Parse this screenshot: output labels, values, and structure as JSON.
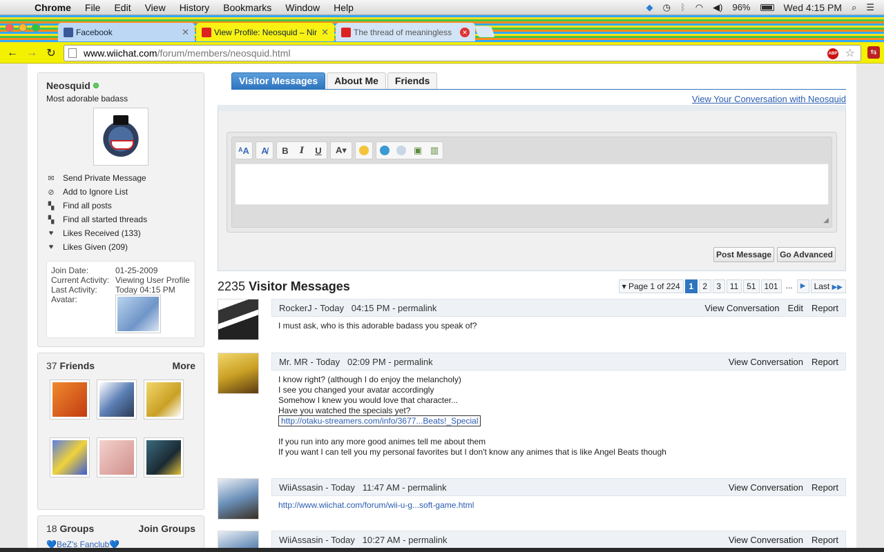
{
  "menubar": {
    "app": "Chrome",
    "items": [
      "File",
      "Edit",
      "View",
      "History",
      "Bookmarks",
      "Window",
      "Help"
    ],
    "battery": "96%",
    "clock": "Wed 4:15 PM"
  },
  "tabs": [
    {
      "title": "Facebook"
    },
    {
      "title": "View Profile: Neosquid – Nin"
    },
    {
      "title": "The thread of meaningless"
    }
  ],
  "toolbar": {
    "url_host": "www.wiichat.com",
    "url_path": "/forum/members/neosquid.html",
    "abp_label": "ABP"
  },
  "profile": {
    "username": "Neosquid",
    "user_title": "Most adorable badass",
    "links": [
      {
        "label": "Send Private Message",
        "icon": "envelope-icon"
      },
      {
        "label": "Add to Ignore List",
        "icon": "block-icon"
      },
      {
        "label": "Find all posts",
        "icon": "posts-icon"
      },
      {
        "label": "Find all started threads",
        "icon": "threads-icon"
      },
      {
        "label": "Likes Received (133)",
        "icon": "heart-icon"
      },
      {
        "label": "Likes Given (209)",
        "icon": "heart-icon"
      }
    ],
    "stats": {
      "join_label": "Join Date:",
      "join_value": "01-25-2009",
      "activity_label": "Current Activity:",
      "activity_value": "Viewing User Profile",
      "last_label": "Last Activity:",
      "last_value": "Today 04:15 PM",
      "avatar_label": "Avatar:"
    }
  },
  "friends": {
    "count": "37",
    "label": "Friends",
    "more": "More",
    "colors": [
      "#e0672a",
      "#5c7fb6",
      "#e8c33e",
      "#3c5bd6",
      "#e8b9b5",
      "#2a4a5e"
    ]
  },
  "groups": {
    "count": "18",
    "label": "Groups",
    "join": "Join Groups",
    "first": "💙BeZ's Fanclub💙"
  },
  "main": {
    "tabs": [
      "Visitor Messages",
      "About Me",
      "Friends"
    ],
    "conv_link": "View Your Conversation with Neosquid",
    "post_button": "Post Message",
    "advanced_button": "Go Advanced",
    "count": "2235",
    "title": "Visitor Messages",
    "pager": {
      "label": "Page 1 of 224",
      "pages": [
        "1",
        "2",
        "3",
        "11",
        "51",
        "101"
      ],
      "ellipsis": "...",
      "last": "Last"
    }
  },
  "messages": [
    {
      "author": "RockerJ",
      "date": "Today",
      "time": "04:15 PM",
      "permalink": "permalink",
      "actions": [
        "View Conversation",
        "Edit",
        "Report"
      ],
      "lines": [
        "I must ask, who is this adorable badass you speak of?"
      ],
      "avatar_color": "#2b2b2b"
    },
    {
      "author": "Mr. MR",
      "date": "Today",
      "time": "02:09 PM",
      "permalink": "permalink",
      "actions": [
        "View Conversation",
        "Report"
      ],
      "lines": [
        "I know right? (although I do enjoy the melancholy)",
        "I see you changed your avatar accordingly",
        "Somehow I knew you would love that character...",
        "Have you watched the specials yet?"
      ],
      "link": "http://otaku-streamers.com/info/3677...Beats!_Special",
      "lines2": [
        "If you run into any more good animes tell me about them",
        "If you want I can tell you my personal favorites but I don't know any animes that is like Angel Beats though"
      ],
      "avatar_color": "#e8c33e"
    },
    {
      "author": "WiiAssasin",
      "date": "Today",
      "time": "11:47 AM",
      "permalink": "permalink",
      "actions": [
        "View Conversation",
        "Report"
      ],
      "link": "http://www.wiichat.com/forum/wii-u-g...soft-game.html",
      "avatar_color": "#6a8fb8"
    },
    {
      "author": "WiiAssasin",
      "date": "Today",
      "time": "10:27 AM",
      "permalink": "permalink",
      "actions": [
        "View Conversation",
        "Report"
      ],
      "avatar_color": "#6a8fb8"
    }
  ]
}
